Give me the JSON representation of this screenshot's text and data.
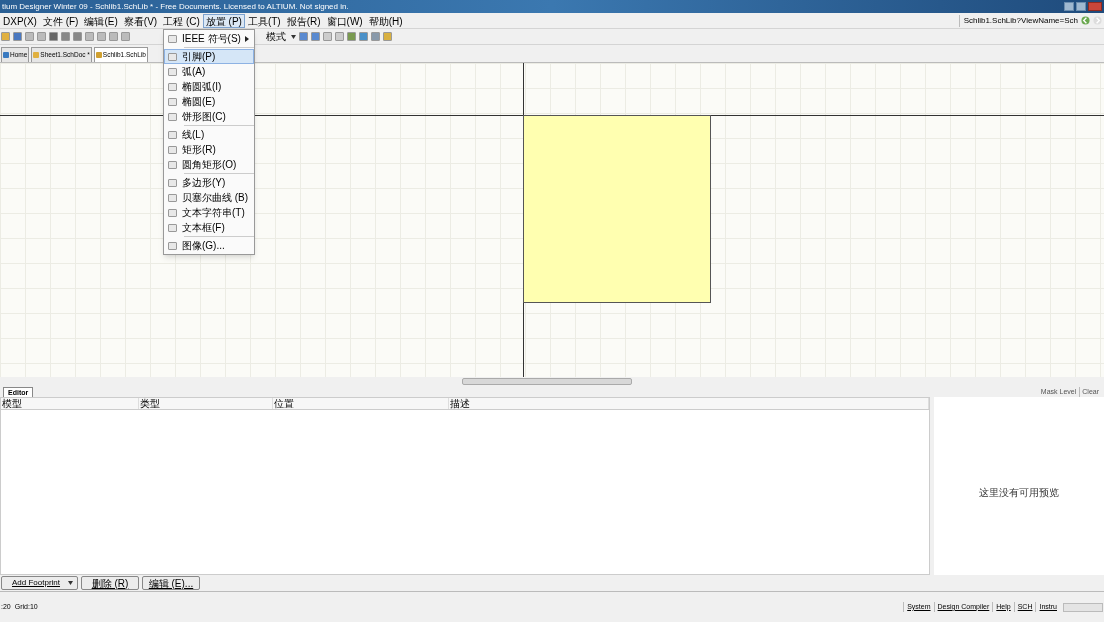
{
  "window": {
    "title": "tium Designer Winter 09 - Schlib1.SchLib * - Free Documents. Licensed to ALTIUM. Not signed in."
  },
  "menu_bar": [
    {
      "label": "DXP(X)",
      "selected": false
    },
    {
      "label": "文件 (F)",
      "selected": false
    },
    {
      "label": "编辑(E)",
      "selected": false
    },
    {
      "label": "察看(V)",
      "selected": false
    },
    {
      "label": "工程 (C)",
      "selected": false
    },
    {
      "label": "放置 (P)",
      "selected": true
    },
    {
      "label": "工具(T)",
      "selected": false
    },
    {
      "label": "报告(R)",
      "selected": false
    },
    {
      "label": "窗口(W)",
      "selected": false
    },
    {
      "label": "帮助(H)",
      "selected": false
    }
  ],
  "navigation": {
    "address": "Schlib1.SchLib?ViewName=Sch"
  },
  "toolbar": {
    "mode_label": "模式"
  },
  "document_tabs": [
    {
      "label": "Home",
      "selected": false
    },
    {
      "label": "Sheet1.SchDoc *",
      "selected": false
    },
    {
      "label": "Schlib1.SchLib",
      "selected": true
    }
  ],
  "place_menu": {
    "groups": [
      [
        {
          "label": "IEEE 符号(S)",
          "submenu": true,
          "selected": false
        }
      ],
      [
        {
          "label": "引脚(P)",
          "submenu": false,
          "selected": true
        },
        {
          "label": "弧(A)",
          "submenu": false,
          "selected": false
        },
        {
          "label": "椭圆弧(I)",
          "submenu": false,
          "selected": false
        },
        {
          "label": "椭圆(E)",
          "submenu": false,
          "selected": false
        },
        {
          "label": "饼形图(C)",
          "submenu": false,
          "selected": false
        }
      ],
      [
        {
          "label": "线(L)",
          "submenu": false,
          "selected": false
        },
        {
          "label": "矩形(R)",
          "submenu": false,
          "selected": false
        },
        {
          "label": "圆角矩形(O)",
          "submenu": false,
          "selected": false
        }
      ],
      [
        {
          "label": "多边形(Y)",
          "submenu": false,
          "selected": false
        },
        {
          "label": "贝塞尔曲线 (B)",
          "submenu": false,
          "selected": false
        },
        {
          "label": "文本字符串(T)",
          "submenu": false,
          "selected": false
        },
        {
          "label": "文本框(F)",
          "submenu": false,
          "selected": false
        }
      ],
      [
        {
          "label": "图像(G)...",
          "submenu": false,
          "selected": false
        }
      ]
    ]
  },
  "editor_panel": {
    "tab": "Editor",
    "columns": [
      "模型",
      "类型",
      "位置",
      "描述"
    ],
    "mask_level": "Mask Level",
    "clear": "Clear",
    "preview_message": "这里没有可用预览",
    "buttons": [
      {
        "label": "Add Footprint",
        "dropdown": true
      },
      {
        "label": "删除 (R)",
        "dropdown": false
      },
      {
        "label": "编辑 (E)...",
        "dropdown": false
      }
    ]
  },
  "status_bar": {
    "coords": ":20",
    "grid": "Grid:10",
    "panels": [
      "System",
      "Design Compiler",
      "Help",
      "SCH",
      "Instru"
    ]
  }
}
